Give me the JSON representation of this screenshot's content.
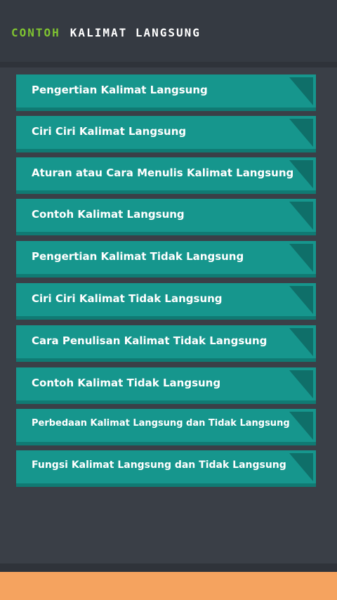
{
  "header": {
    "title_part1": "CONTOH",
    "title_part2": "KALIMAT LANGSUNG"
  },
  "colors": {
    "header_bg": "#353a42",
    "title_accent": "#7fc331",
    "item_bg": "#16968d",
    "footer": "#f5a35f"
  },
  "menu": {
    "items": [
      {
        "label": "Pengertian Kalimat Langsung"
      },
      {
        "label": "Ciri Ciri Kalimat Langsung"
      },
      {
        "label": "Aturan atau Cara Menulis Kalimat Langsung"
      },
      {
        "label": "Contoh Kalimat Langsung"
      },
      {
        "label": "Pengertian Kalimat Tidak Langsung"
      },
      {
        "label": "Ciri Ciri Kalimat Tidak Langsung"
      },
      {
        "label": "Cara Penulisan Kalimat Tidak Langsung"
      },
      {
        "label": "Contoh Kalimat Tidak Langsung"
      },
      {
        "label": "Perbedaan Kalimat Langsung dan Tidak Langsung"
      },
      {
        "label": "Fungsi Kalimat Langsung dan Tidak Langsung"
      }
    ]
  }
}
